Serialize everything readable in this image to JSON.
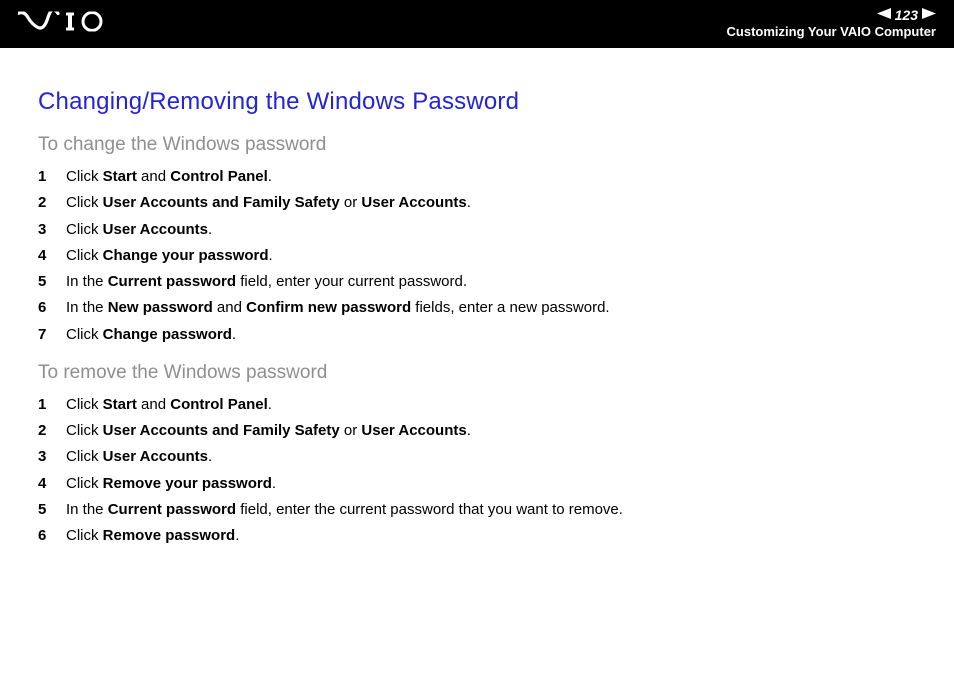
{
  "header": {
    "page_number": "123",
    "section": "Customizing Your VAIO Computer"
  },
  "title": "Changing/Removing the Windows Password",
  "section1": {
    "heading": "To change the Windows password",
    "steps": [
      {
        "n": "1",
        "pre": "Click ",
        "b1": "Start",
        "mid": " and ",
        "b2": "Control Panel",
        "post": "."
      },
      {
        "n": "2",
        "pre": "Click ",
        "b1": "User Accounts and Family Safety",
        "mid": " or ",
        "b2": "User Accounts",
        "post": "."
      },
      {
        "n": "3",
        "pre": "Click ",
        "b1": "User Accounts",
        "mid": "",
        "b2": "",
        "post": "."
      },
      {
        "n": "4",
        "pre": "Click ",
        "b1": "Change your password",
        "mid": "",
        "b2": "",
        "post": "."
      },
      {
        "n": "5",
        "pre": "In the ",
        "b1": "Current password",
        "mid": " field, enter your current password.",
        "b2": "",
        "post": ""
      },
      {
        "n": "6",
        "pre": "In the ",
        "b1": "New password",
        "mid": " and ",
        "b2": "Confirm new password",
        "post": " fields, enter a new password."
      },
      {
        "n": "7",
        "pre": "Click ",
        "b1": "Change password",
        "mid": "",
        "b2": "",
        "post": "."
      }
    ]
  },
  "section2": {
    "heading": "To remove the Windows password",
    "steps": [
      {
        "n": "1",
        "pre": "Click ",
        "b1": "Start",
        "mid": " and ",
        "b2": "Control Panel",
        "post": "."
      },
      {
        "n": "2",
        "pre": "Click ",
        "b1": "User Accounts and Family Safety",
        "mid": " or ",
        "b2": "User Accounts",
        "post": "."
      },
      {
        "n": "3",
        "pre": "Click ",
        "b1": "User Accounts",
        "mid": "",
        "b2": "",
        "post": "."
      },
      {
        "n": "4",
        "pre": "Click ",
        "b1": "Remove your password",
        "mid": "",
        "b2": "",
        "post": "."
      },
      {
        "n": "5",
        "pre": "In the ",
        "b1": "Current password",
        "mid": " field, enter the current password that you want to remove.",
        "b2": "",
        "post": ""
      },
      {
        "n": "6",
        "pre": "Click ",
        "b1": "Remove password",
        "mid": "",
        "b2": "",
        "post": "."
      }
    ]
  }
}
